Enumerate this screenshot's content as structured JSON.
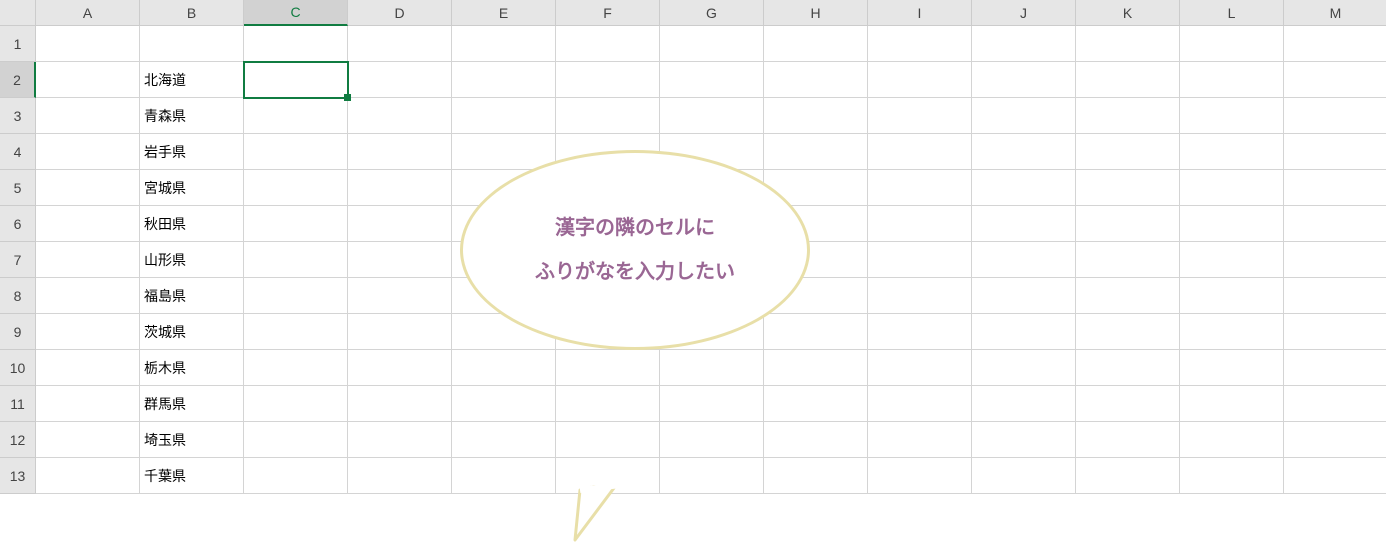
{
  "columns": [
    "A",
    "B",
    "C",
    "D",
    "E",
    "F",
    "G",
    "H",
    "I",
    "J",
    "K",
    "L",
    "M"
  ],
  "rows": [
    "1",
    "2",
    "3",
    "4",
    "5",
    "6",
    "7",
    "8",
    "9",
    "10",
    "11",
    "12",
    "13"
  ],
  "active_column": "C",
  "active_row": "2",
  "selected_cell": "C2",
  "data": {
    "B2": "北海道",
    "B3": "青森県",
    "B4": "岩手県",
    "B5": "宮城県",
    "B6": "秋田県",
    "B7": "山形県",
    "B8": "福島県",
    "B9": "茨城県",
    "B10": "栃木県",
    "B11": "群馬県",
    "B12": "埼玉県",
    "B13": "千葉県"
  },
  "callout": {
    "line1": "漢字の隣のセルに",
    "line2": "ふりがなを入力したい"
  }
}
